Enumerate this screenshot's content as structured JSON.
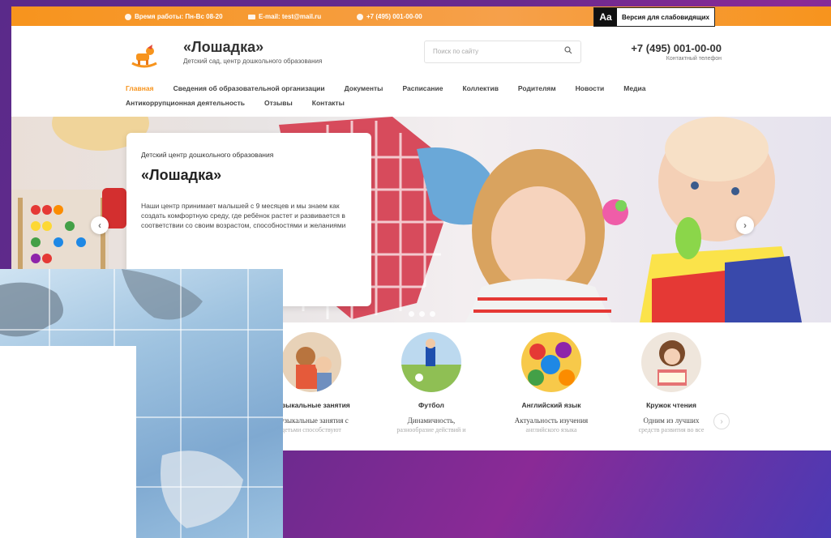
{
  "topbar": {
    "hours": "Время работы: Пн-Вс 08-20",
    "email": "E-mail: test@mail.ru",
    "phone": "+7 (495) 001-00-00",
    "vision_badge": "Aa",
    "vision_label": "Версия для слабовидящих"
  },
  "header": {
    "title": "«Лошадка»",
    "subtitle": "Детский сад, центр дошкольного образования",
    "search_placeholder": "Поиск по сайту",
    "phone": "+7 (495) 001-00-00",
    "phone_caption": "Контактный телефон"
  },
  "nav": {
    "row1": [
      {
        "label": "Главная",
        "active": true
      },
      {
        "label": "Сведения об образовательной организации",
        "active": false
      },
      {
        "label": "Документы",
        "active": false
      },
      {
        "label": "Расписание",
        "active": false
      },
      {
        "label": "Коллектив",
        "active": false
      },
      {
        "label": "Родителям",
        "active": false
      },
      {
        "label": "Новости",
        "active": false
      },
      {
        "label": "Медиа",
        "active": false
      }
    ],
    "row2": [
      {
        "label": "Антикоррупционная деятельность",
        "active": false
      },
      {
        "label": "Отзывы",
        "active": false
      },
      {
        "label": "Контакты",
        "active": false
      }
    ]
  },
  "hero": {
    "kicker": "Детский центр дошкольного образования",
    "title": "«Лошадка»",
    "text": "Наши центр принимает малышей с 9 месяцев и мы знаем как создать комфортную среду, где ребёнок растет и развивается в соответствии со своим возрастом, способностями и желаниями"
  },
  "features": [
    {
      "title": "Музыкальные занятия",
      "text": "Музыкальные занятия с",
      "text2": "детьми способствуют"
    },
    {
      "title": "Футбол",
      "text": "Динамичность,",
      "text2": "разнообразие действий и"
    },
    {
      "title": "Английский язык",
      "text": "Актуальность изучения",
      "text2": "английского языка"
    },
    {
      "title": "Кружок чтения",
      "text": "Одним из лучших",
      "text2": "средств развития во все"
    }
  ],
  "colors": {
    "accent": "#f7941d",
    "text": "#333333",
    "background_outer": "#6a2a8e"
  }
}
